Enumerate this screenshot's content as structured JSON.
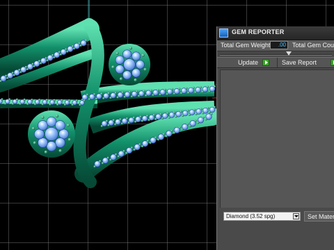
{
  "panel": {
    "title": "GEM REPORTER",
    "total_gem_weight_label": "Total Gem Weight",
    "total_gem_weight_value": ".00",
    "total_gem_count_label": "Total Gem Cou",
    "update_label": "Update",
    "save_report_label": "Save Report",
    "material_value": "Diamond    (3.52 spg)",
    "set_material_label": "Set Materi"
  },
  "icons": {
    "app_icon": "gem-reporter-app-icon",
    "update_play": "play-icon",
    "save_play": "play-icon",
    "dropdown": "chevron-down-icon"
  },
  "colors": {
    "viewport_bg": "#000000",
    "grid": "#8c8c8c",
    "metal": "#12906a",
    "gem": "#7fb6ff",
    "panel_bg": "#4a4a4a",
    "value_text": "#4ec3ff",
    "play_green": "#3ea52c"
  }
}
